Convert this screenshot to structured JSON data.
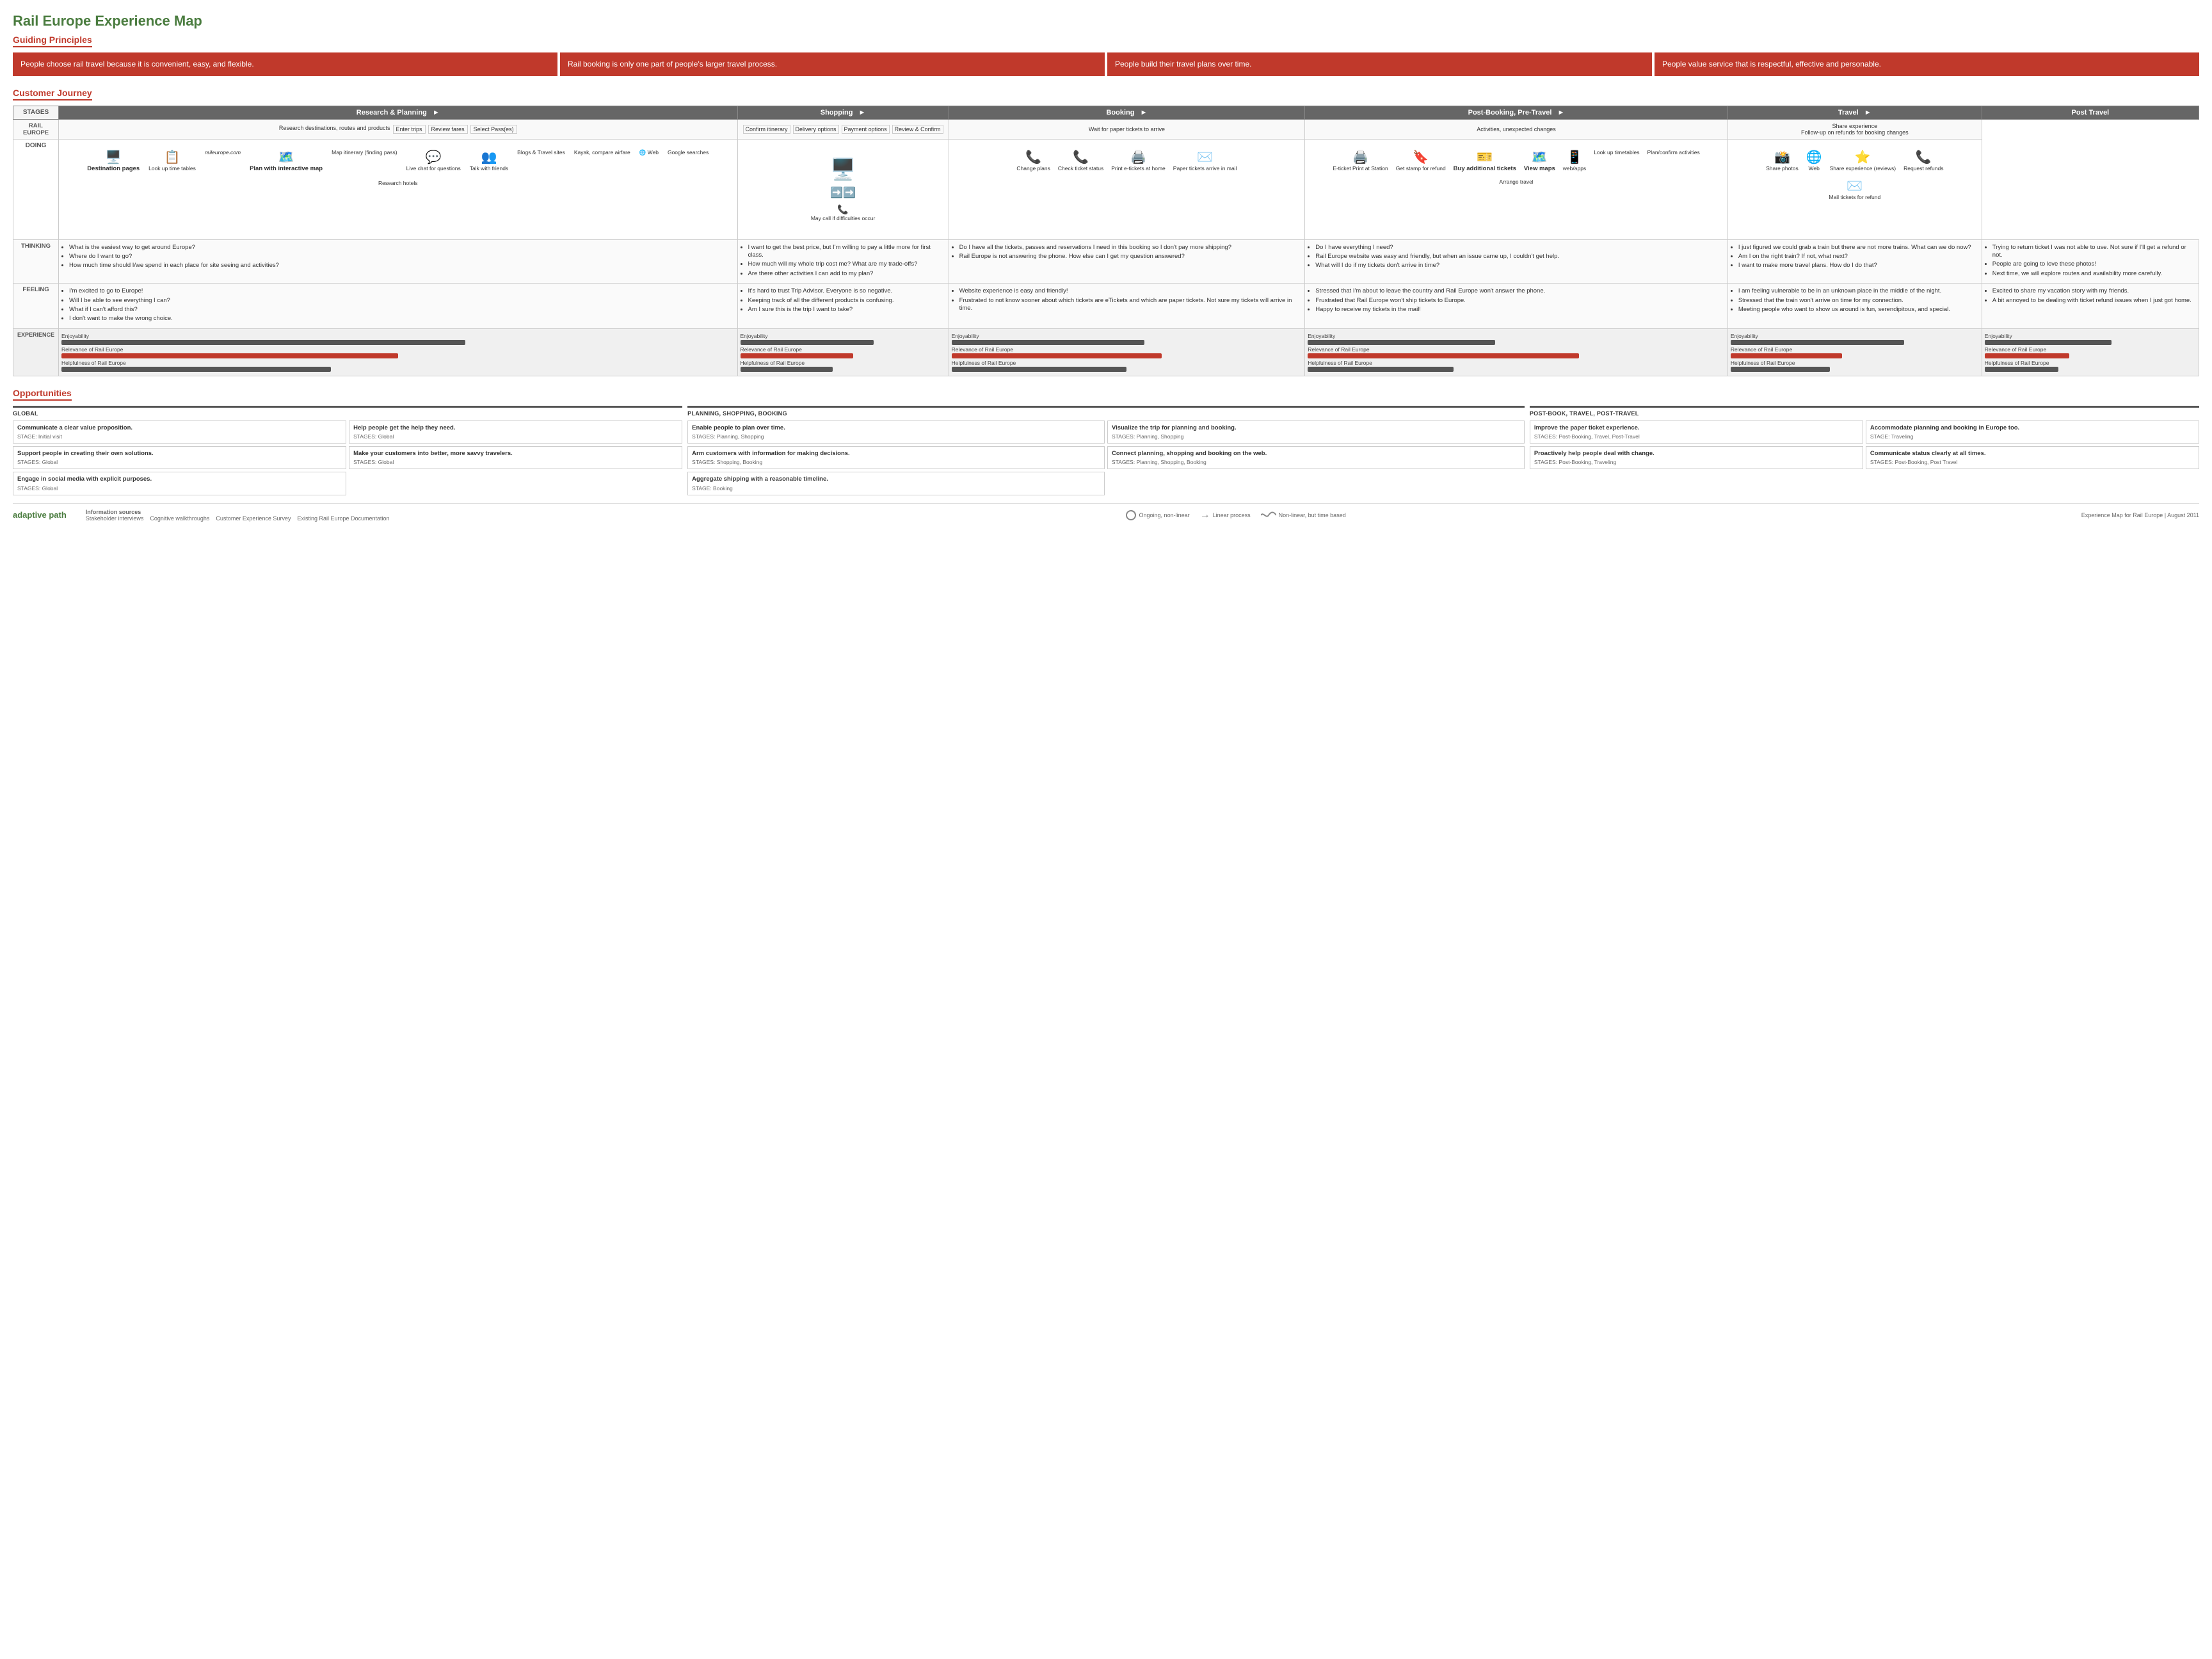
{
  "title": "Rail Europe Experience Map",
  "guiding_principles": {
    "label": "Guiding Principles",
    "items": [
      "People choose rail travel because it is convenient, easy, and flexible.",
      "Rail booking is only one part of people's larger travel process.",
      "People build their travel plans over time.",
      "People value service that is respectful, effective and personable."
    ]
  },
  "customer_journey": {
    "label": "Customer Journey",
    "stages": [
      "Research & Planning",
      "Shopping",
      "Booking",
      "Post-Booking, Pre-Travel",
      "Travel",
      "Post Travel"
    ],
    "rows": {
      "stages_label": "STAGES",
      "rail_europe_label": "RAIL EUROPE",
      "doing_label": "DOING",
      "thinking_label": "THINKING",
      "feeling_label": "FEELING",
      "experience_label": "EXPERIENCE"
    },
    "rail_europe": [
      "Research destinations, routes and products / Enter trips / Review fares / Select Pass(es)",
      "Confirm itinerary / Delivery options / Payment options / Review & Confirm",
      "Wait for paper tickets to arrive",
      "Activities, unexpected changes",
      "Share experience / Follow-up on refunds for booking changes"
    ],
    "doing": [
      "Destination pages / Look up time tables / raileurope.com / Plan with interactive map / Map itinerary (finding pass) / Live chat for questions / Blogs & Travel sites / Kayak, compare airfare / Web / Google searches / Research hotels / Talk with friends",
      "May call if difficulties occur",
      "Change plans / Check ticket status / Print e-tickets at home / Paper tickets arrive in mail",
      "E-ticket Print at Station / Get stamp for refund / Buy additional tickets / View maps / web/apps / Look up timetables / Plan/confirm activities / Arrange travel",
      "Share photos / Web / Share experience (reviews) / Request refunds / Mail tickets for refund"
    ],
    "thinking": [
      "• What is the easiest way to get around Europe?\n• Where do I want to go?\n• How much time should I/we spend in each place for site seeing and activities?",
      "• I want to get the best price, but I'm willing to pay a little more for first class.\n• How much will my whole trip cost me? What are my trade-offs?\n• Are there other activities I can add to my plan?",
      "• Do I have all the tickets, passes and reservations I need in this booking so I don't pay more shipping?\n• Rail Europe is not answering the phone. How else can I get my question answered?",
      "• Do I have everything I need?\n• Rail Europe website was easy and friendly, but when an issue came up, I couldn't get help.\n• What will I do if my tickets don't arrive in time?",
      "• I just figured we could grab a train but there are not more trains. What can we do now?\n• Am I on the right train? If not, what next?\n• I want to make more travel plans. How do I do that?",
      "• Trying to return ticket I was not able to use. Not sure if I'll get a refund or not.\n• People are going to love these photos!\n• Next time, we will explore routes and availability more carefully."
    ],
    "feeling": [
      "• I'm excited to go to Europe!\n• Will I be able to see everything I can?\n• What if I can't afford this?\n• I don't want to make the wrong choice.",
      "• It's hard to trust Trip Advisor. Everyone is so negative.\n• Keeping track of all the different products is confusing.\n• Am I sure this is the trip I want to take?",
      "• Website experience is easy and friendly!\n• Frustrated to not know sooner about which tickets are eTickets and which are paper tickets. Not sure my tickets will arrive in time.",
      "• Stressed that I'm about to leave the country and Rail Europe won't answer the phone.\n• Frustrated that Rail Europe won't ship tickets to Europe.\n• Happy to receive my tickets in the mail!",
      "• I am feeling vulnerable to be in an unknown place in the middle of the night.\n• Stressed that the train won't arrive on time for my connection.\n• Meeting people who want to show us around is fun, serendipitous, and special.",
      "• Excited to share my vacation story with my friends.\n• A bit annoyed to be dealing with ticket refund issues when I just got home."
    ],
    "experience_bars": {
      "enjoyability_label": "Enjoyability",
      "relevance_label": "Relevance of Rail Europe",
      "helpfulness_label": "Helpfulness of Rail Europe",
      "bars": [
        {
          "enjoyability": 60,
          "relevance": 50,
          "helpfulness": 40
        },
        {
          "enjoyability": 65,
          "relevance": 55,
          "helpfulness": 45
        },
        {
          "enjoyability": 55,
          "relevance": 60,
          "helpfulness": 50
        },
        {
          "enjoyability": 45,
          "relevance": 65,
          "helpfulness": 35
        },
        {
          "enjoyability": 70,
          "relevance": 45,
          "helpfulness": 40
        },
        {
          "enjoyability": 60,
          "relevance": 40,
          "helpfulness": 35
        }
      ]
    }
  },
  "opportunities": {
    "label": "Opportunities",
    "global_label": "GLOBAL",
    "planning_label": "PLANNING, SHOPPING, BOOKING",
    "postbook_label": "POST-BOOK, TRAVEL, POST-TRAVEL",
    "global_cards": [
      {
        "title": "Communicate a clear value proposition.",
        "stage": "STAGE: Initial visit"
      },
      {
        "title": "Help people get the help they need.",
        "stage": "STAGES: Global"
      },
      {
        "title": "Support people in creating their own solutions.",
        "stage": "STAGES: Global"
      },
      {
        "title": "Make your customers into better, more savvy travelers.",
        "stage": "STAGES: Global"
      },
      {
        "title": "Engage in social media with explicit purposes.",
        "stage": "STAGES: Global"
      }
    ],
    "planning_cards": [
      {
        "title": "Enable people to plan over time.",
        "stage": "STAGES: Planning, Shopping"
      },
      {
        "title": "Visualize the trip for planning and booking.",
        "stage": "STAGES: Planning, Shopping"
      },
      {
        "title": "Arm customers with information for making decisions.",
        "stage": "STAGES: Shopping, Booking"
      },
      {
        "title": "Connect planning, shopping and booking on the web.",
        "stage": "STAGES: Planning, Shopping, Booking"
      },
      {
        "title": "Aggregate shipping with a reasonable timeline.",
        "stage": "STAGE: Booking"
      }
    ],
    "postbook_cards": [
      {
        "title": "Improve the paper ticket experience.",
        "stage": "STAGES: Post-Booking, Travel, Post-Travel"
      },
      {
        "title": "Accommodate planning and booking in Europe too.",
        "stage": "STAGE: Traveling"
      },
      {
        "title": "Proactively help people deal with change.",
        "stage": "STAGES: Post-Booking, Traveling"
      },
      {
        "title": "Communicate status clearly at all times.",
        "stage": "STAGES: Post-Booking, Post Travel"
      }
    ]
  },
  "footer": {
    "sources_label": "Information sources",
    "sources": [
      "Stakeholder interviews",
      "Cognitive walkthroughs",
      "Customer Experience Survey",
      "Existing Rail Europe Documentation"
    ],
    "legend": {
      "ongoing_label": "Ongoing, non-linear",
      "linear_label": "Linear process",
      "nonlinear_label": "Non-linear, but time based"
    },
    "brand": "adaptive path",
    "credit": "Experience Map for Rail Europe  |  August 2011"
  }
}
